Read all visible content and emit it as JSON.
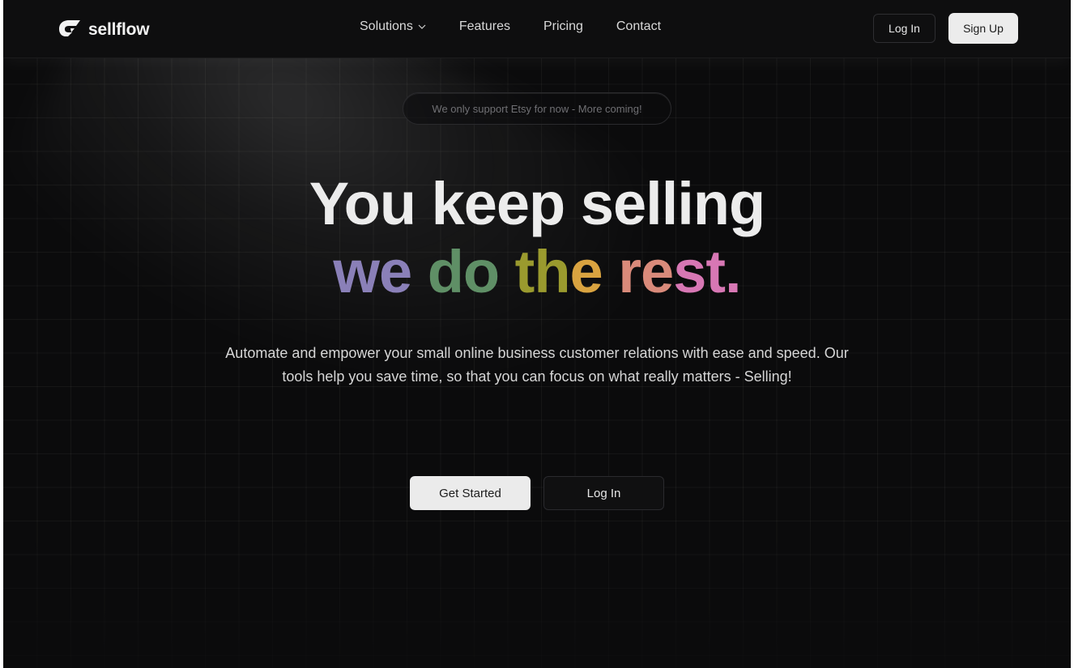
{
  "brand": {
    "name": "sellflow",
    "logo_icon": "sellflow-logo-icon"
  },
  "nav": {
    "items": [
      {
        "label": "Solutions",
        "has_dropdown": true
      },
      {
        "label": "Features"
      },
      {
        "label": "Pricing"
      },
      {
        "label": "Contact"
      }
    ]
  },
  "header_actions": {
    "login": "Log In",
    "signup": "Sign Up"
  },
  "hero": {
    "notice": "We only support Etsy for now - More coming!",
    "headline_line1": "You keep selling",
    "headline_line2_words": [
      "we",
      "do",
      "th",
      "e",
      "re",
      "st."
    ],
    "description": "Automate and empower your small online business customer relations with ease and speed. Our tools help you save time, so that you can focus on what really matters - Selling!",
    "primary_cta": "Get Started",
    "secondary_cta": "Log In"
  },
  "colors": {
    "background": "#0b0b0c",
    "accent_purple": "#8a80b8",
    "accent_green": "#5f8f66",
    "accent_olive": "#9a9a2e",
    "accent_amber": "#d9a340",
    "accent_salmon": "#d98a7a",
    "accent_pink": "#d777b4"
  }
}
